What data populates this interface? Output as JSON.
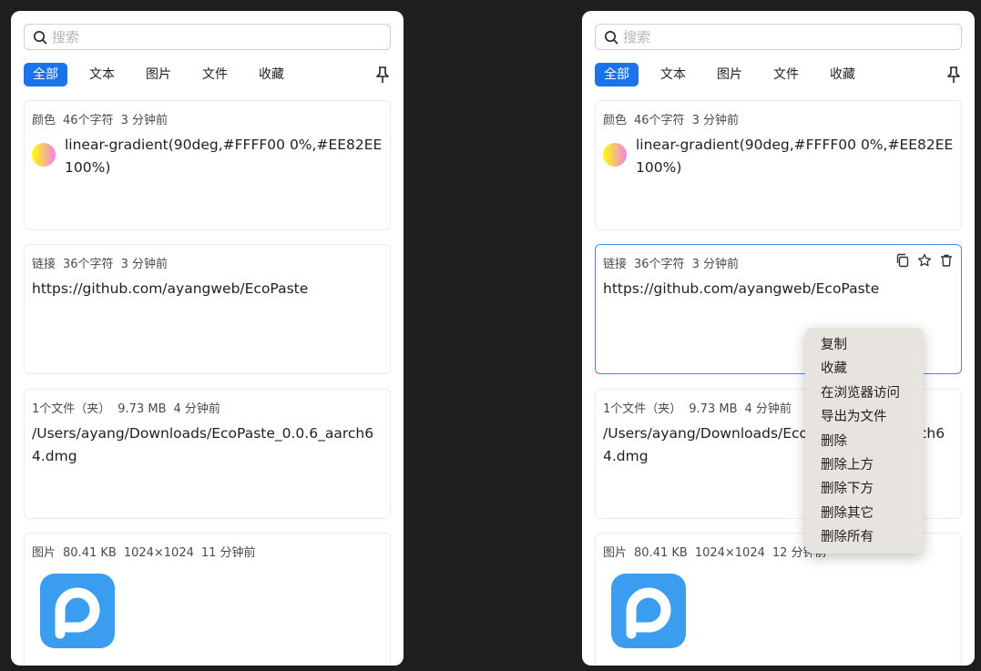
{
  "search": {
    "placeholder": "搜索"
  },
  "tabs": [
    "全部",
    "文本",
    "图片",
    "文件",
    "收藏"
  ],
  "colors": {
    "accent": "#1a73e8",
    "selected_border": "#3a8ef6",
    "menu_bg": "#e7e3df",
    "swatch_start": "#FFFF00",
    "swatch_end": "#EE82EE",
    "app_icon": "#3a9df0"
  },
  "left_cards": {
    "color": {
      "type": "颜色",
      "chars": "46个字符",
      "time": "3 分钟前",
      "content": "linear-gradient(90deg,#FFFF00 0%,#EE82EE 100%)"
    },
    "link": {
      "type": "链接",
      "chars": "36个字符",
      "time": "3 分钟前",
      "content": "https://github.com/ayangweb/EcoPaste"
    },
    "file": {
      "type": "1个文件（夹）",
      "size": "9.73 MB",
      "time": "4 分钟前",
      "content": "/Users/ayang/Downloads/EcoPaste_0.0.6_aarch64.dmg"
    },
    "image": {
      "type": "图片",
      "size": "80.41 KB",
      "dims": "1024×1024",
      "time": "11 分钟前"
    }
  },
  "right_cards": {
    "color": {
      "type": "颜色",
      "chars": "46个字符",
      "time": "3 分钟前",
      "content": "linear-gradient(90deg,#FFFF00 0%,#EE82EE 100%)"
    },
    "link": {
      "type": "链接",
      "chars": "36个字符",
      "time": "3 分钟前",
      "content": "https://github.com/ayangweb/EcoPaste"
    },
    "file": {
      "type": "1个文件（夹）",
      "size": "9.73 MB",
      "time": "4 分钟前",
      "content": "/Users/ayang/Downloads/EcoPaste_0.0.6_aarch64.dmg"
    },
    "image": {
      "type": "图片",
      "size": "80.41 KB",
      "dims": "1024×1024",
      "time": "12 分钟前"
    }
  },
  "card_tools": [
    "copy-icon",
    "star-icon",
    "trash-icon"
  ],
  "context_menu": [
    "复制",
    "收藏",
    "在浏览器访问",
    "导出为文件",
    "删除",
    "删除上方",
    "删除下方",
    "删除其它",
    "删除所有"
  ]
}
